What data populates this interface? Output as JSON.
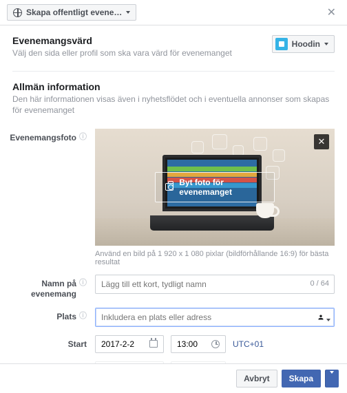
{
  "header": {
    "create_label": "Skapa offentligt evene…"
  },
  "host_section": {
    "title": "Evenemangsvärd",
    "subtitle": "Välj den sida eller profil som ska vara värd för evenemanget",
    "host_name": "Hoodin"
  },
  "general_section": {
    "title": "Allmän information",
    "subtitle": "Den här informationen visas även i nyhetsflödet och i eventuella annonser som skapas för evenemanget"
  },
  "photo": {
    "label": "Evenemangsfoto",
    "change_label": "Byt foto för evenemanget",
    "hint": "Använd en bild på 1 920 x 1 080 pixlar (bildförhållande 16:9) för bästa resultat"
  },
  "name_field": {
    "label": "Namn på evenemang",
    "placeholder": "Lägg till ett kort, tydligt namn",
    "counter": "0 / 64"
  },
  "location_field": {
    "label": "Plats",
    "placeholder": "Inkludera en plats eller adress"
  },
  "start": {
    "label": "Start",
    "date": "2017-2-2",
    "time": "13:00",
    "tz": "UTC+01"
  },
  "footer": {
    "cancel": "Avbryt",
    "create": "Skapa"
  }
}
